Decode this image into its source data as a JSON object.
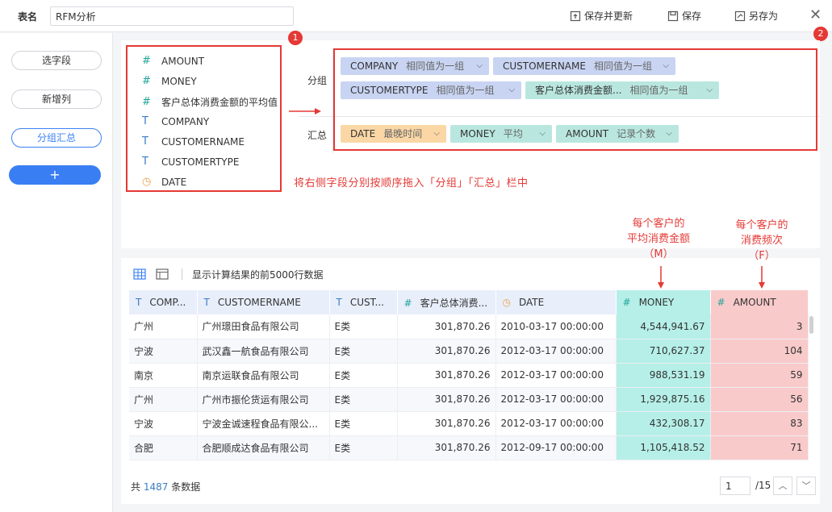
{
  "topbar": {
    "table_name_label": "表名",
    "table_name_value": "RFM分析",
    "save_update_label": "保存并更新",
    "save_label": "保存",
    "save_as_label": "另存为"
  },
  "leftnav": {
    "items": [
      {
        "label": "选字段"
      },
      {
        "label": "新增列"
      },
      {
        "label": "分组汇总"
      }
    ],
    "add_label": "+"
  },
  "fields": [
    {
      "type": "number",
      "name": "AMOUNT"
    },
    {
      "type": "number",
      "name": "MONEY"
    },
    {
      "type": "number",
      "name": "客户总体消费金额的平均值"
    },
    {
      "type": "text",
      "name": "COMPANY"
    },
    {
      "type": "text",
      "name": "CUSTOMERNAME"
    },
    {
      "type": "text",
      "name": "CUSTOMERTYPE"
    },
    {
      "type": "date",
      "name": "DATE"
    }
  ],
  "badges": {
    "one": "1",
    "two": "2"
  },
  "group": {
    "label": "分组",
    "tags": [
      {
        "name": "COMPANY",
        "mode": "相同值为一组"
      },
      {
        "name": "CUSTOMERNAME",
        "mode": "相同值为一组"
      },
      {
        "name": "CUSTOMERTYPE",
        "mode": "相同值为一组"
      },
      {
        "name": "客户总体消费金额...",
        "mode": "相同值为一组"
      }
    ]
  },
  "summary": {
    "label": "汇总",
    "tags": [
      {
        "name": "DATE",
        "mode": "最晚时间"
      },
      {
        "name": "MONEY",
        "mode": "平均"
      },
      {
        "name": "AMOUNT",
        "mode": "记录个数"
      }
    ]
  },
  "hint": "将右侧字段分别按顺序拖入「分组」「汇总」栏中",
  "annotations": {
    "money_line1": "每个客户的",
    "money_line2": "平均消费金额",
    "money_line3": "（M）",
    "amount_line1": "每个客户的",
    "amount_line2": "消费频次",
    "amount_line3": "（F）"
  },
  "preview_note": "显示计算结果的前5000行数据",
  "table": {
    "columns": [
      {
        "icon": "T",
        "label": "COMP..."
      },
      {
        "icon": "T",
        "label": "CUSTOMERNAME"
      },
      {
        "icon": "T",
        "label": "CUST..."
      },
      {
        "icon": "#",
        "label": "客户总体消费..."
      },
      {
        "icon": "clock",
        "label": "DATE"
      },
      {
        "icon": "#",
        "label": "MONEY"
      },
      {
        "icon": "#",
        "label": "AMOUNT"
      }
    ],
    "rows": [
      [
        "广州",
        "广州璟田食品有限公司",
        "E类",
        "301,870.26",
        "2010-03-17 00:00:00",
        "4,544,941.67",
        "3"
      ],
      [
        "宁波",
        "武汉鑫一航食品有限公司",
        "E类",
        "301,870.26",
        "2012-03-17 00:00:00",
        "710,627.37",
        "104"
      ],
      [
        "南京",
        "南京运联食品有限公司",
        "E类",
        "301,870.26",
        "2012-03-17 00:00:00",
        "988,531.19",
        "59"
      ],
      [
        "广州",
        "广州市振伦货运有限公司",
        "E类",
        "301,870.26",
        "2012-03-17 00:00:00",
        "1,929,875.16",
        "56"
      ],
      [
        "宁波",
        "宁波金诚速程食品有限公...",
        "E类",
        "301,870.26",
        "2012-03-17 00:00:00",
        "432,308.17",
        "83"
      ],
      [
        "合肥",
        "合肥顺成达食品有限公司",
        "E类",
        "301,870.26",
        "2012-09-17 00:00:00",
        "1,105,418.52",
        "71"
      ]
    ]
  },
  "footer": {
    "total_prefix": "共",
    "total_count": "1487",
    "total_suffix": "条数据",
    "page_current": "1",
    "page_total": "/15"
  },
  "colors": {
    "accent": "#3a7ef3",
    "annotation_red": "#e53935",
    "money_col": "#b5efe8",
    "amount_col": "#f9caca"
  }
}
